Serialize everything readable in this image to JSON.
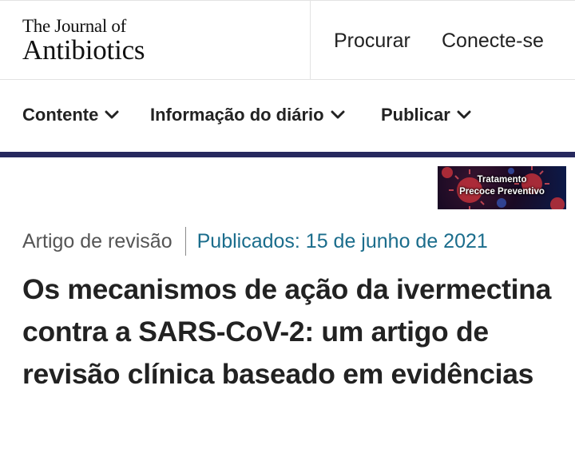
{
  "journal": {
    "title_line1": "The Journal of",
    "title_line2": "Antibiotics"
  },
  "header": {
    "search_label": "Procurar",
    "login_label": "Conecte-se"
  },
  "nav": {
    "items": [
      {
        "label": "Contente",
        "icon": "chevron-down-icon"
      },
      {
        "label": "Informação do diário",
        "icon": "chevron-down-icon"
      },
      {
        "label": "Publicar",
        "icon": "chevron-down-icon"
      }
    ],
    "accent_color": "#27295e"
  },
  "ad": {
    "line1": "Tratamento",
    "line2": "Precoce Preventivo"
  },
  "article": {
    "type": "Artigo de revisão",
    "published": "Publicados: 15 de junho de 2021",
    "title": "Os mecanismos de ação da ivermectina contra a SARS-CoV-2: um artigo de revisão clínica baseado em evidências",
    "date_color": "#1b6d8c"
  }
}
